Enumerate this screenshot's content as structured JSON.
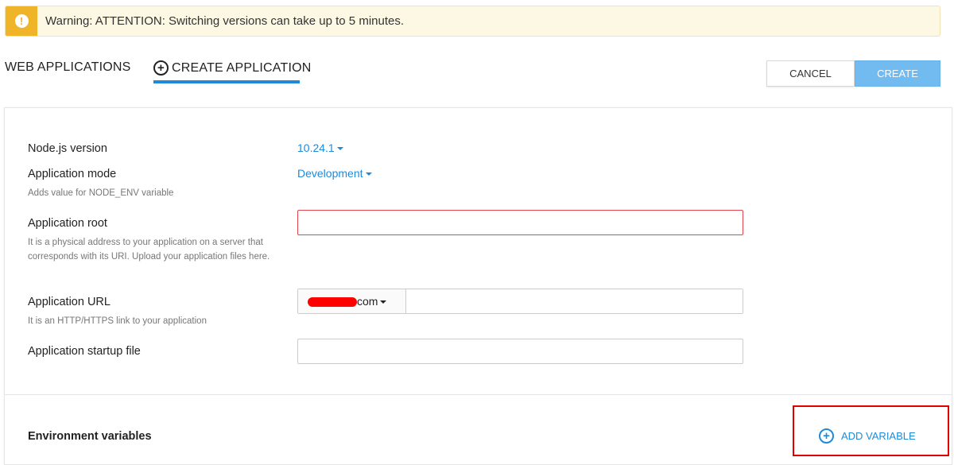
{
  "warning": {
    "icon": "exclamation-icon",
    "text": "Warning: ATTENTION: Switching versions can take up to 5 minutes."
  },
  "nav": {
    "web_applications": "WEB APPLICATIONS",
    "create_application": "CREATE APPLICATION"
  },
  "buttons": {
    "cancel": "CANCEL",
    "create": "CREATE"
  },
  "form": {
    "nodejs_version": {
      "label": "Node.js version",
      "value": "10.24.1"
    },
    "app_mode": {
      "label": "Application mode",
      "value": "Development",
      "hint": "Adds value for NODE_ENV variable"
    },
    "app_root": {
      "label": "Application root",
      "value": "",
      "hint": "It is a physical address to your application on a server that corresponds with its URI. Upload your application files here."
    },
    "app_url": {
      "label": "Application URL",
      "domain_suffix": "com",
      "path_value": "",
      "hint": "It is an HTTP/HTTPS link to your application"
    },
    "startup_file": {
      "label": "Application startup file",
      "value": ""
    }
  },
  "env": {
    "title": "Environment variables",
    "add_variable": "ADD VARIABLE"
  },
  "colors": {
    "accent": "#1f8ad8",
    "warning": "#f0b429",
    "error": "#e2454a",
    "create_button": "#72bbf0",
    "highlight": "#e00000"
  }
}
